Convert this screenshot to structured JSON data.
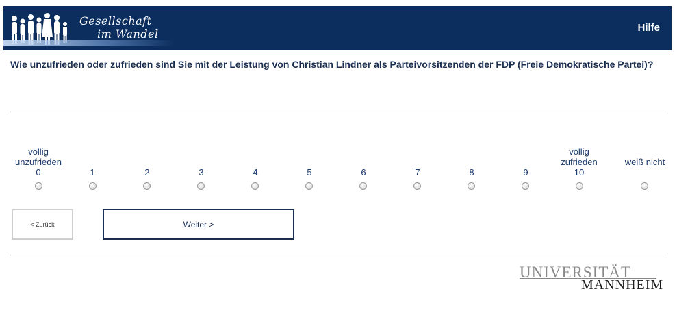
{
  "header": {
    "logo_line1": "Gesellschaft",
    "logo_line2": "im Wandel",
    "help_label": "Hilfe",
    "colors": {
      "bar": "#0b2e5e",
      "text": "#ffffff"
    }
  },
  "question": {
    "text": "Wie unzufrieden oder zufrieden sind Sie mit der Leistung von Christian Lindner als Parteivorsitzenden der FDP (Freie Demokratische Partei)?"
  },
  "scale": {
    "left_anchor": "völlig unzufrieden",
    "right_anchor": "völlig zufrieden",
    "options": [
      "0",
      "1",
      "2",
      "3",
      "4",
      "5",
      "6",
      "7",
      "8",
      "9",
      "10"
    ],
    "dont_know": "weiß nicht",
    "selected": null
  },
  "nav": {
    "back_label": "< Zurück",
    "next_label": "Weiter >"
  },
  "footer": {
    "uni_line1": "UNIVERSITÄT",
    "uni_line2": "MANNHEIM"
  }
}
